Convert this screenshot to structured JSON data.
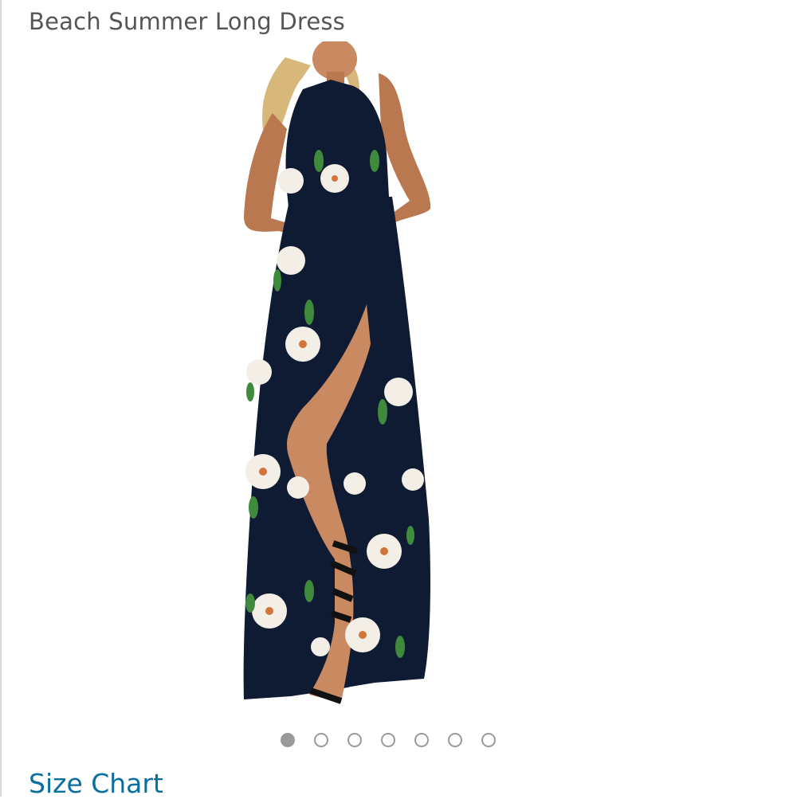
{
  "product": {
    "title": "Beach Summer Long Dress"
  },
  "image": {
    "description_icon": "product-photo",
    "dress_color": "#0f1a33",
    "flower_color": "#f3efe6",
    "leaf_color": "#3f8a3c"
  },
  "carousel": {
    "count": 7,
    "active_index": 0
  },
  "links": {
    "size_chart": "Size Chart"
  },
  "colors": {
    "link": "#0a6ea0",
    "title": "#555555",
    "dot": "#9a9a9a"
  }
}
